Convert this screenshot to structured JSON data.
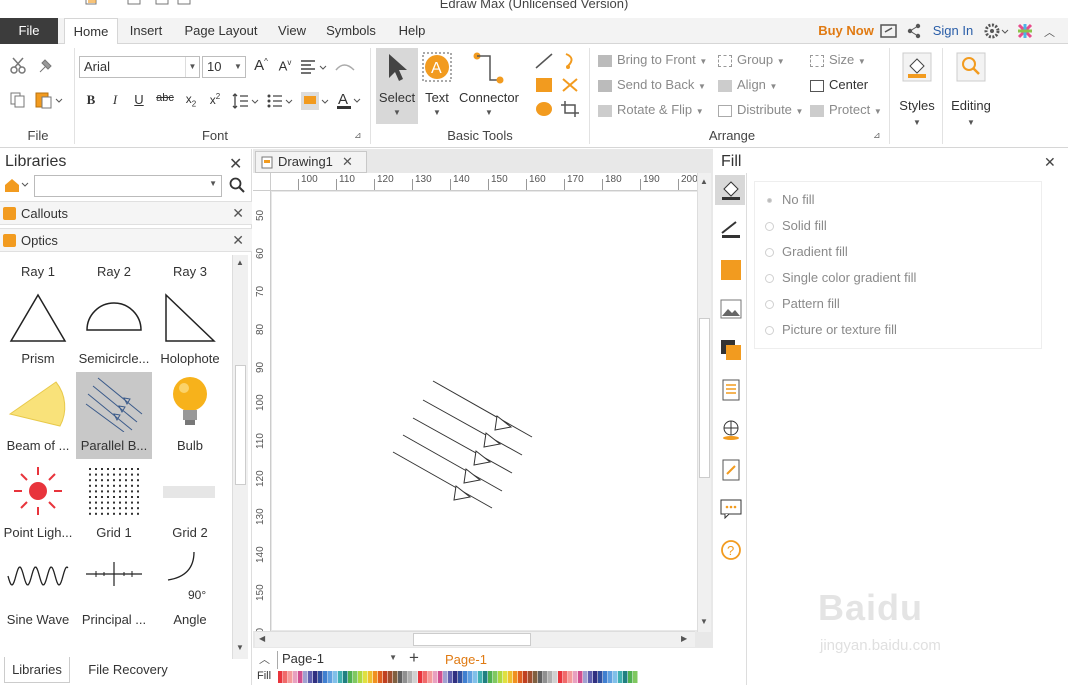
{
  "app": {
    "title": "Edraw Max (Unlicensed Version)"
  },
  "tabs": {
    "file": "File",
    "home": "Home",
    "insert": "Insert",
    "page_layout": "Page Layout",
    "view": "View",
    "symbols": "Symbols",
    "help": "Help"
  },
  "topright": {
    "buy_now": "Buy Now",
    "sign_in": "Sign In"
  },
  "ribbon": {
    "file_group": "File",
    "font_group": "Font",
    "font_name": "Arial",
    "font_size": "10",
    "basic_tools_group": "Basic Tools",
    "select": "Select",
    "text": "Text",
    "connector": "Connector",
    "arrange_group": "Arrange",
    "bring_to_front": "Bring to Front",
    "send_to_back": "Send to Back",
    "rotate_flip": "Rotate & Flip",
    "group": "Group",
    "align": "Align",
    "distribute": "Distribute",
    "size": "Size",
    "center": "Center",
    "protect": "Protect",
    "styles": "Styles",
    "editing": "Editing"
  },
  "libraries": {
    "title": "Libraries",
    "search_placeholder": "",
    "callouts": "Callouts",
    "optics": "Optics",
    "shapes": [
      {
        "label": "Ray 1",
        "icon": "ray-1-icon"
      },
      {
        "label": "Ray 2",
        "icon": "ray-2-icon"
      },
      {
        "label": "Ray 3",
        "icon": "ray-3-icon"
      },
      {
        "label": "Prism",
        "icon": "prism-icon"
      },
      {
        "label": "Semicircle...",
        "icon": "semicircle-icon"
      },
      {
        "label": "Holophote",
        "icon": "holophote-icon"
      },
      {
        "label": "Beam of ...",
        "icon": "beam-icon"
      },
      {
        "label": "Parallel B...",
        "icon": "parallel-beam-icon"
      },
      {
        "label": "Bulb",
        "icon": "bulb-icon"
      },
      {
        "label": "Point Ligh...",
        "icon": "point-light-icon"
      },
      {
        "label": "Grid 1",
        "icon": "grid-1-icon"
      },
      {
        "label": "Grid 2",
        "icon": "grid-2-icon"
      },
      {
        "label": "Sine Wave",
        "icon": "sine-wave-icon"
      },
      {
        "label": "Principal ...",
        "icon": "principal-axis-icon"
      },
      {
        "label": "Angle",
        "icon": "angle-icon"
      }
    ],
    "angle_value": "90°",
    "bottom_tabs": [
      "Libraries",
      "File Recovery"
    ]
  },
  "document": {
    "tab": "Drawing1",
    "ruler_h": [
      "100",
      "110",
      "120",
      "130",
      "140",
      "150",
      "160",
      "170",
      "180",
      "190",
      "200"
    ],
    "ruler_v": [
      "50",
      "60",
      "70",
      "80",
      "90",
      "100",
      "110",
      "120",
      "130",
      "140",
      "150",
      "60"
    ]
  },
  "pages": {
    "current": "Page-1",
    "active_tab": "Page-1",
    "fill_label": "Fill"
  },
  "fill_panel": {
    "title": "Fill",
    "options": [
      "No fill",
      "Solid fill",
      "Gradient fill",
      "Single color gradient fill",
      "Pattern fill",
      "Picture or texture fill"
    ]
  },
  "colors": {
    "accent": "#f29b1f",
    "buy_now": "#e07a12"
  },
  "watermark": {
    "text1": "Baidu",
    "text2": "jingyan.baidu.com"
  }
}
